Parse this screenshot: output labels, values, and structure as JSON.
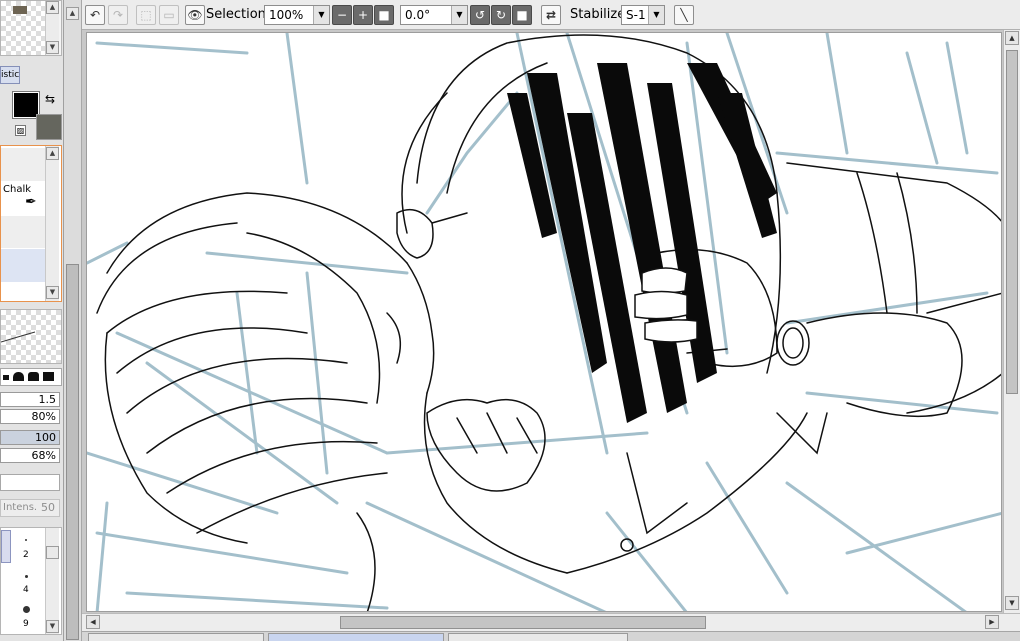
{
  "toolbar": {
    "selection_label": "Selection",
    "zoom": "100%",
    "rotation": "0.0°",
    "stabilizer_label": "Stabilizer",
    "stabilizer_value": "S-1"
  },
  "left_panel": {
    "mode_label": "istic",
    "tool_name": "Chalk",
    "brush_size": "1.5",
    "min_size": "80%",
    "density": "100",
    "min_density": "68%",
    "intensity_label": "Intens.",
    "intensity_value": "50",
    "size_presets": [
      "2",
      "4",
      "9"
    ]
  },
  "colors": {
    "primary": "#000000",
    "secondary": "#65665e",
    "accent": "#e8924c",
    "sketch_blue": "#9ab9c6"
  },
  "doc_tabs": [
    {
      "label": ""
    },
    {
      "label": ""
    },
    {
      "label": ""
    }
  ]
}
